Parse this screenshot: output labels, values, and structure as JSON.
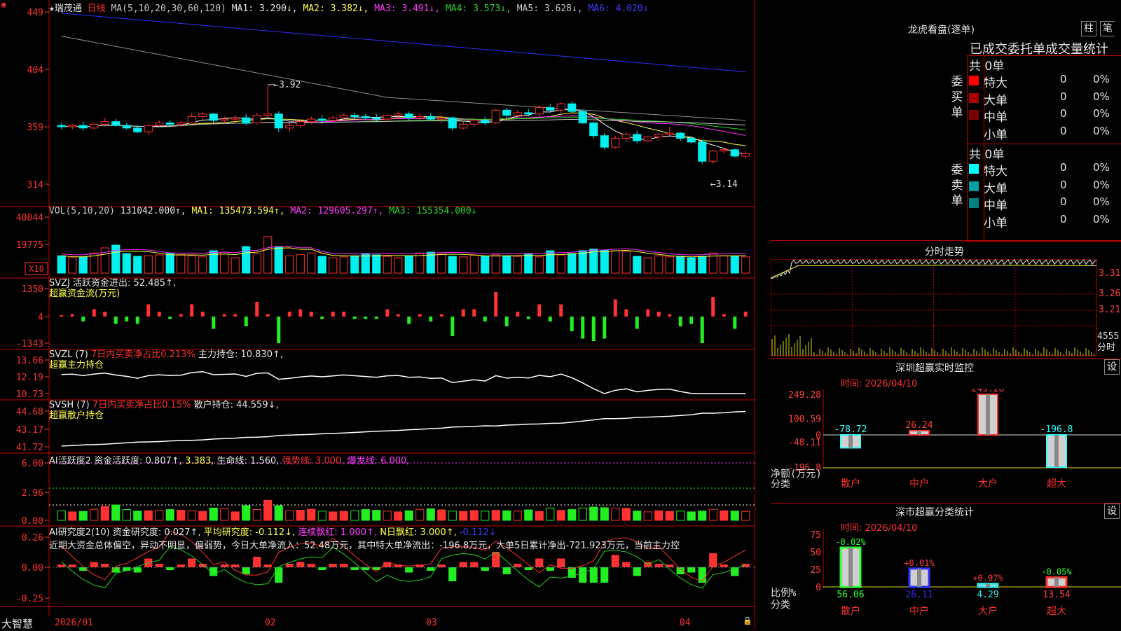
{
  "stock": {
    "name": "瑞茂通",
    "period": "日线"
  },
  "main_header": {
    "ma_label": "MA(5,10,20,30,60,120)",
    "ma1": "MA1: 3.290↓,",
    "ma2": "MA2: 3.382↓,",
    "ma3": "MA3: 3.491↓,",
    "ma4": "MA4: 3.573↓,",
    "ma5": "MA5: 3.628↓,",
    "ma6": "MA6: 4.020↓"
  },
  "price_axis": [
    "449",
    "404",
    "359",
    "314"
  ],
  "annotations": {
    "high": "←3.92",
    "low": "←3.14"
  },
  "vol_header": {
    "label": "VOL(5,10,20)",
    "value": "131042.000↑,",
    "ma1": "MA1: 135473.594↑,",
    "ma2": "MA2: 129605.297↑,",
    "ma3": "MA3: 155354.000↓"
  },
  "vol_axis": [
    "40044",
    "19775",
    "X10"
  ],
  "svzj": {
    "label": "SVZJ  活跃资金进出: 52.485↑,",
    "sub": "超赢资金流(万元)",
    "axis": [
      "1350",
      "4",
      "-1343"
    ]
  },
  "svzl": {
    "label": "SVZL (7)",
    "ratio": "7日内买卖净占比0.213%",
    "hold": "主力持仓: 10.830↑,",
    "sub": "超赢主力持仓",
    "axis": [
      "13.66",
      "12.19",
      "10.73"
    ]
  },
  "svsh": {
    "label": "SVSH (7)",
    "ratio": "7日内买卖净占比0.15%",
    "hold": "散户持仓: 44.559↓,",
    "sub": "超赢散户持仓",
    "axis": [
      "44.68",
      "43.17",
      "41.72"
    ]
  },
  "ai_active": {
    "label": "AI活跃度2",
    "v1": "资金活跃度: 0.807↑,",
    "v2": "3.383,",
    "v3": "生命线: 1.560,",
    "v4": "强势线: 3.000,",
    "v5": "爆发线: 6.000,",
    "axis": [
      "6.00",
      "2.96",
      "0.00"
    ]
  },
  "ai_research": {
    "label": "AI研究度2(10)",
    "v1": "资金研究度: 0.027↑,",
    "v2": "平均研究度: -0.112↓,",
    "v3": "连续飘红: 1.000↑,",
    "v4": "N日飘红: 3.000↑,",
    "v5": "-0.112↓",
    "commentary": "近期大资金总体偏空，异动不明显，偏弱势，今日大单净流入：52.48万元，其中特大单净流出：-196.8万元，大单5日累计净出-721.923万元，当前主力控",
    "axis": [
      "0.26",
      "0.00",
      "-0.25"
    ]
  },
  "date_axis": {
    "brand": "大智慧",
    "labels": [
      "2026/01",
      "02",
      "03",
      "04"
    ]
  },
  "dragon_tiger": {
    "title": "龙虎看盘(逐单)",
    "btn1": "柱",
    "btn2": "笔",
    "subtitle": "已成交委托单成交量统计",
    "buy": {
      "side": "委买单",
      "total": "共 0单",
      "rows": [
        {
          "label": "特大",
          "count": "0",
          "pct": "0%",
          "color": "#ff0000"
        },
        {
          "label": "大单",
          "count": "0",
          "pct": "0%",
          "color": "#aa0000"
        },
        {
          "label": "中单",
          "count": "0",
          "pct": "0%",
          "color": "#7a0000"
        },
        {
          "label": "小单",
          "count": "0",
          "pct": "0%",
          "color": "#000000"
        }
      ]
    },
    "sell": {
      "side": "委卖单",
      "total": "共 0单",
      "rows": [
        {
          "label": "特大",
          "count": "0",
          "pct": "0%",
          "color": "#00ffff"
        },
        {
          "label": "大单",
          "count": "0",
          "pct": "0%",
          "color": "#00a0a0"
        },
        {
          "label": "中单",
          "count": "0",
          "pct": "0%",
          "color": "#008080"
        },
        {
          "label": "小单",
          "count": "0",
          "pct": "0%",
          "color": "#000000"
        }
      ]
    }
  },
  "intraday": {
    "title": "分时走势",
    "axis": [
      "3.310",
      "3.260",
      "3.210"
    ],
    "vol_max": "4555",
    "vol_label": "分时"
  },
  "sz_monitor": {
    "title": "深圳超赢实时监控",
    "btn": "设",
    "time": "时间: 2026/04/10",
    "axis": [
      "249.28",
      "100.59",
      "0",
      "-48.11",
      "-196.8"
    ],
    "y_label": "净额(万元)",
    "x_label": "分类",
    "categories": [
      "散户",
      "中户",
      "大户",
      "超大"
    ],
    "values": [
      -78.72,
      26.24,
      249.28,
      -196.8
    ],
    "value_labels": [
      "-78.72",
      "26.24",
      "249.28",
      "-196.8"
    ]
  },
  "sz_class": {
    "title": "深市超赢分类统计",
    "btn": "设",
    "time": "时间: 2026/04/10",
    "axis": [
      "75",
      "50",
      "25",
      "0"
    ],
    "y_label": "比例%",
    "x_label": "分类",
    "categories": [
      "散户",
      "中户",
      "大户",
      "超大"
    ],
    "values": [
      56.06,
      26.11,
      4.29,
      13.54
    ],
    "value_labels": [
      "56.06",
      "26.11",
      "4.29",
      "13.54"
    ],
    "change_labels": [
      "-0.02%",
      "+0.01%",
      "+0.07%",
      "-0.05%"
    ]
  },
  "chart_data": {
    "type": "candlestick",
    "ylim": [
      3.14,
      4.49
    ],
    "ohlc": [
      [
        3.6,
        3.62,
        3.57,
        3.59
      ],
      [
        3.59,
        3.61,
        3.57,
        3.6
      ],
      [
        3.6,
        3.63,
        3.56,
        3.58
      ],
      [
        3.58,
        3.62,
        3.57,
        3.61
      ],
      [
        3.61,
        3.66,
        3.59,
        3.63
      ],
      [
        3.63,
        3.65,
        3.59,
        3.6
      ],
      [
        3.6,
        3.62,
        3.57,
        3.58
      ],
      [
        3.58,
        3.6,
        3.54,
        3.55
      ],
      [
        3.55,
        3.61,
        3.53,
        3.6
      ],
      [
        3.6,
        3.64,
        3.59,
        3.62
      ],
      [
        3.62,
        3.64,
        3.59,
        3.61
      ],
      [
        3.61,
        3.64,
        3.59,
        3.62
      ],
      [
        3.62,
        3.7,
        3.61,
        3.67
      ],
      [
        3.67,
        3.7,
        3.64,
        3.69
      ],
      [
        3.69,
        3.7,
        3.62,
        3.64
      ],
      [
        3.64,
        3.67,
        3.61,
        3.65
      ],
      [
        3.65,
        3.68,
        3.62,
        3.66
      ],
      [
        3.66,
        3.69,
        3.6,
        3.62
      ],
      [
        3.62,
        3.7,
        3.61,
        3.68
      ],
      [
        3.68,
        3.92,
        3.65,
        3.69
      ],
      [
        3.69,
        3.71,
        3.55,
        3.58
      ],
      [
        3.58,
        3.62,
        3.55,
        3.6
      ],
      [
        3.6,
        3.65,
        3.58,
        3.63
      ],
      [
        3.63,
        3.67,
        3.61,
        3.65
      ],
      [
        3.65,
        3.68,
        3.62,
        3.64
      ],
      [
        3.64,
        3.68,
        3.62,
        3.66
      ],
      [
        3.66,
        3.7,
        3.64,
        3.68
      ],
      [
        3.68,
        3.7,
        3.65,
        3.67
      ],
      [
        3.67,
        3.69,
        3.64,
        3.66
      ],
      [
        3.66,
        3.69,
        3.63,
        3.65
      ],
      [
        3.65,
        3.69,
        3.63,
        3.68
      ],
      [
        3.68,
        3.71,
        3.65,
        3.69
      ],
      [
        3.69,
        3.71,
        3.64,
        3.66
      ],
      [
        3.66,
        3.7,
        3.64,
        3.67
      ],
      [
        3.67,
        3.7,
        3.64,
        3.65
      ],
      [
        3.65,
        3.68,
        3.62,
        3.66
      ],
      [
        3.66,
        3.67,
        3.56,
        3.58
      ],
      [
        3.58,
        3.63,
        3.57,
        3.61
      ],
      [
        3.61,
        3.66,
        3.59,
        3.64
      ],
      [
        3.64,
        3.67,
        3.6,
        3.62
      ],
      [
        3.62,
        3.73,
        3.61,
        3.72
      ],
      [
        3.72,
        3.74,
        3.66,
        3.68
      ],
      [
        3.68,
        3.72,
        3.66,
        3.7
      ],
      [
        3.7,
        3.73,
        3.67,
        3.69
      ],
      [
        3.69,
        3.76,
        3.67,
        3.74
      ],
      [
        3.74,
        3.77,
        3.7,
        3.72
      ],
      [
        3.72,
        3.78,
        3.7,
        3.77
      ],
      [
        3.77,
        3.79,
        3.7,
        3.71
      ],
      [
        3.71,
        3.72,
        3.61,
        3.62
      ],
      [
        3.62,
        3.63,
        3.5,
        3.52
      ],
      [
        3.52,
        3.54,
        3.41,
        3.43
      ],
      [
        3.43,
        3.52,
        3.42,
        3.5
      ],
      [
        3.5,
        3.55,
        3.47,
        3.53
      ],
      [
        3.53,
        3.56,
        3.46,
        3.48
      ],
      [
        3.48,
        3.52,
        3.47,
        3.51
      ],
      [
        3.51,
        3.54,
        3.48,
        3.53
      ],
      [
        3.53,
        3.59,
        3.52,
        3.54
      ],
      [
        3.54,
        3.55,
        3.48,
        3.5
      ],
      [
        3.5,
        3.51,
        3.46,
        3.47
      ],
      [
        3.47,
        3.49,
        3.3,
        3.32
      ],
      [
        3.32,
        3.41,
        3.3,
        3.4
      ],
      [
        3.4,
        3.42,
        3.38,
        3.41
      ],
      [
        3.41,
        3.42,
        3.35,
        3.36
      ],
      [
        3.36,
        3.4,
        3.34,
        3.38
      ]
    ],
    "vol_ratio": [
      0.62,
      0.55,
      0.58,
      0.72,
      0.9,
      1.0,
      0.7,
      0.6,
      0.62,
      0.65,
      0.7,
      0.66,
      0.62,
      0.58,
      0.8,
      0.75,
      0.55,
      0.95,
      0.7,
      1.3,
      0.95,
      0.62,
      0.66,
      0.72,
      0.6,
      0.55,
      0.58,
      0.62,
      0.7,
      0.65,
      0.6,
      0.55,
      0.62,
      0.72,
      0.75,
      0.68,
      0.6,
      0.58,
      0.64,
      0.6,
      0.65,
      0.62,
      0.6,
      0.68,
      0.58,
      0.8,
      0.65,
      0.7,
      0.8,
      0.86,
      0.82,
      0.8,
      0.78,
      0.6,
      0.55,
      0.62,
      0.58,
      0.6,
      0.55,
      0.6,
      0.72,
      0.62,
      0.6,
      0.58,
      0.65,
      0.55,
      0.5,
      0.5
    ]
  }
}
